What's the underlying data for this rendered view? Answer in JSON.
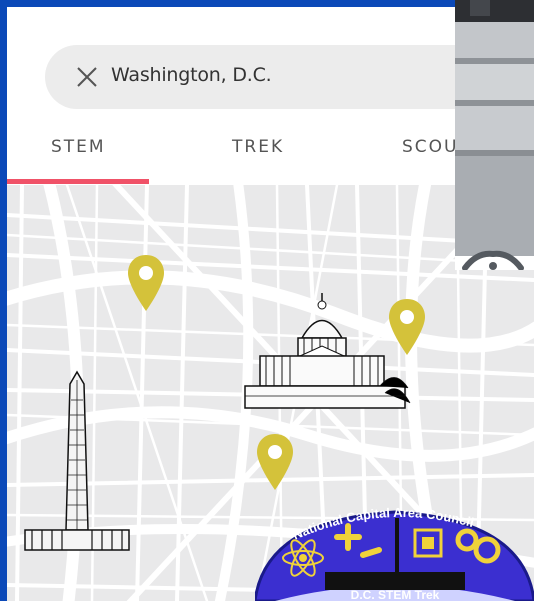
{
  "search": {
    "value": "Washington, D.C.",
    "clear_icon": "close-icon"
  },
  "tabs": [
    {
      "label": "STEM",
      "active": true
    },
    {
      "label": "TREK",
      "active": false
    },
    {
      "label": "SCOUT",
      "active": false
    }
  ],
  "colors": {
    "accent": "#f05268",
    "pin": "#d4c23a",
    "frame": "#0b49b8",
    "map_bg": "#e9e9ea"
  },
  "map": {
    "pins": [
      "pin-1",
      "pin-2",
      "pin-3"
    ],
    "landmarks": [
      "washington-monument",
      "us-capitol"
    ]
  },
  "patch": {
    "title": "National Capital Area Council",
    "subtitle": "D.C. STEM Trek"
  }
}
